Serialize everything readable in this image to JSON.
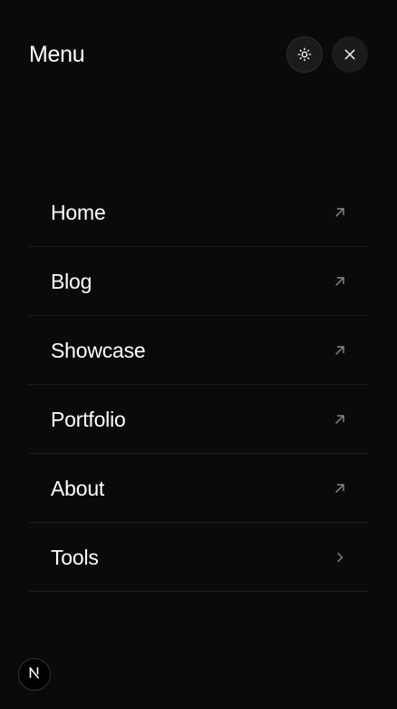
{
  "header": {
    "title": "Menu",
    "theme_toggle_icon": "sun-icon",
    "close_icon": "close-icon"
  },
  "menu": {
    "items": [
      {
        "label": "Home",
        "icon": "arrow-up-right-icon"
      },
      {
        "label": "Blog",
        "icon": "arrow-up-right-icon"
      },
      {
        "label": "Showcase",
        "icon": "arrow-up-right-icon"
      },
      {
        "label": "Portfolio",
        "icon": "arrow-up-right-icon"
      },
      {
        "label": "About",
        "icon": "arrow-up-right-icon"
      },
      {
        "label": "Tools",
        "icon": "chevron-right-icon"
      }
    ]
  },
  "footer": {
    "badge_icon": "nextjs-logo-icon"
  },
  "colors": {
    "background": "#0a0a0a",
    "text": "#ffffff",
    "icon_muted": "#8a8a8a",
    "button_bg": "#1b1b1b",
    "divider": "#1d1d1d"
  }
}
